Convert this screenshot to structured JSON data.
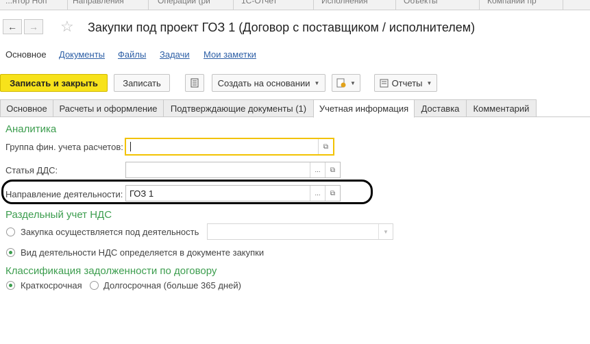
{
  "top_strip": [
    "...нтор Ноп",
    "Направления",
    "Операции (ри",
    "1С-Отчет",
    "Исполнения",
    "Объекты",
    "Компании пр"
  ],
  "nav": {
    "back": "←",
    "forward": "→"
  },
  "title": "Закупки под проект ГОЗ 1 (Договор с поставщиком / исполнителем)",
  "section_links": [
    "Основное",
    "Документы",
    "Файлы",
    "Задачи",
    "Мои заметки"
  ],
  "toolbar": {
    "save_close": "Записать и закрыть",
    "save": "Записать",
    "create_based": "Создать на основании",
    "reports": "Отчеты"
  },
  "tabs": [
    "Основное",
    "Расчеты и оформление",
    "Подтверждающие документы (1)",
    "Учетная информация",
    "Доставка",
    "Комментарий"
  ],
  "active_tab": "Учетная информация",
  "analytics": {
    "title": "Аналитика",
    "fin_group_label": "Группа фин. учета расчетов:",
    "fin_group_value": "",
    "dds_label": "Статья ДДС:",
    "dds_value": "",
    "direction_label": "Направление деятельности:",
    "direction_value": "ГОЗ 1"
  },
  "vat": {
    "title": "Раздельный учет НДС",
    "opt1": "Закупка осуществляется под деятельность",
    "opt1_value": "",
    "opt2": "Вид деятельности НДС определяется в документе закупки",
    "selected": "opt2"
  },
  "debt": {
    "title": "Классификация задолженности по договору",
    "short": "Краткосрочная",
    "long": "Долгосрочная (больше 365 дней)",
    "selected": "short"
  },
  "colors": {
    "accent_green": "#3c9d4e",
    "primary_yellow": "#f7e21b",
    "link_blue": "#2d5fa6"
  }
}
